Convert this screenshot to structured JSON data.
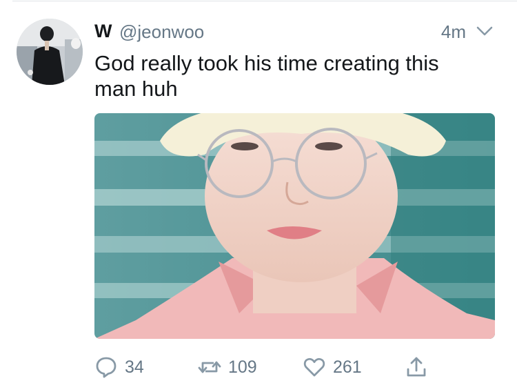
{
  "tweet": {
    "display_name": "W",
    "handle": "@jeonwoo",
    "timestamp": "4m",
    "text": "God really took his time creating this man huh"
  },
  "media": {
    "description_icon": "photo"
  },
  "actions": {
    "reply_count": "34",
    "retweet_count": "109",
    "like_count": "261"
  },
  "colors": {
    "text_primary": "#14171a",
    "text_secondary": "#657786",
    "divider": "#dfe3e6"
  }
}
